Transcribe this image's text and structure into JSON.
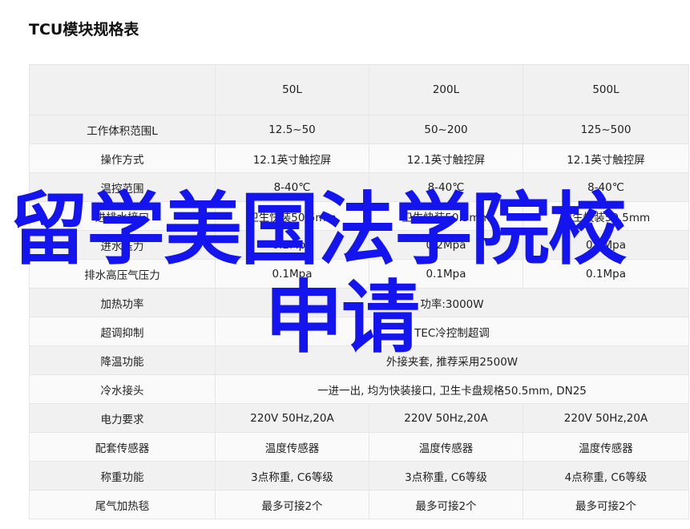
{
  "page_title": "TCU模块规格表",
  "table": {
    "columns": [
      "",
      "50L",
      "200L",
      "500L"
    ],
    "rows": [
      {
        "label": "工作体积范围L",
        "values": [
          "12.5~50",
          "50~200",
          "125~500"
        ]
      },
      {
        "label": "操作方式",
        "values": [
          "12.1英寸触控屏",
          "12.1英寸触控屏",
          "12.1英寸触控屏"
        ]
      },
      {
        "label": "温控范围",
        "values": [
          "8-40℃",
          "8-40℃",
          "8-40℃"
        ]
      },
      {
        "label": "进排水接口",
        "values": [
          "卫生快装50.5mm",
          "卫生快装50.5mm",
          "卫生快装50.5mm"
        ]
      },
      {
        "label": "进水压力",
        "values": [
          "0.2Mpa",
          "0.2Mpa",
          "0.2Mpa"
        ]
      },
      {
        "label": "排水高压气压力",
        "values": [
          "0.1Mpa",
          "0.1Mpa",
          "0.1Mpa"
        ]
      },
      {
        "label": "加热功率",
        "span": "功率:3000W"
      },
      {
        "label": "超调抑制",
        "span": "TEC冷控制超调"
      },
      {
        "label": "降温功能",
        "span": "外接夹套, 推荐采用2500W"
      },
      {
        "label": "冷水接头",
        "span": "一进一出, 均为快装接口, 卫生卡盘规格50.5mm, DN25"
      },
      {
        "label": "电力要求",
        "values": [
          "220V 50Hz,20A",
          "220V 50Hz,20A",
          "220V 50Hz,20A"
        ]
      },
      {
        "label": "配套传感器",
        "values": [
          "温度传感器",
          "温度传感器",
          "温度传感器"
        ]
      },
      {
        "label": "称重功能",
        "values": [
          "3点称重, C6等级",
          "3点称重, C6等级",
          "4点称重, C6等级"
        ]
      },
      {
        "label": "尾气加热毯",
        "values": [
          "最多可接2个",
          "最多可接2个",
          "最多可接2个"
        ]
      }
    ]
  },
  "watermark": {
    "line1": "留学美国法学院校",
    "line2": "申请",
    "color": "#1414ee"
  }
}
